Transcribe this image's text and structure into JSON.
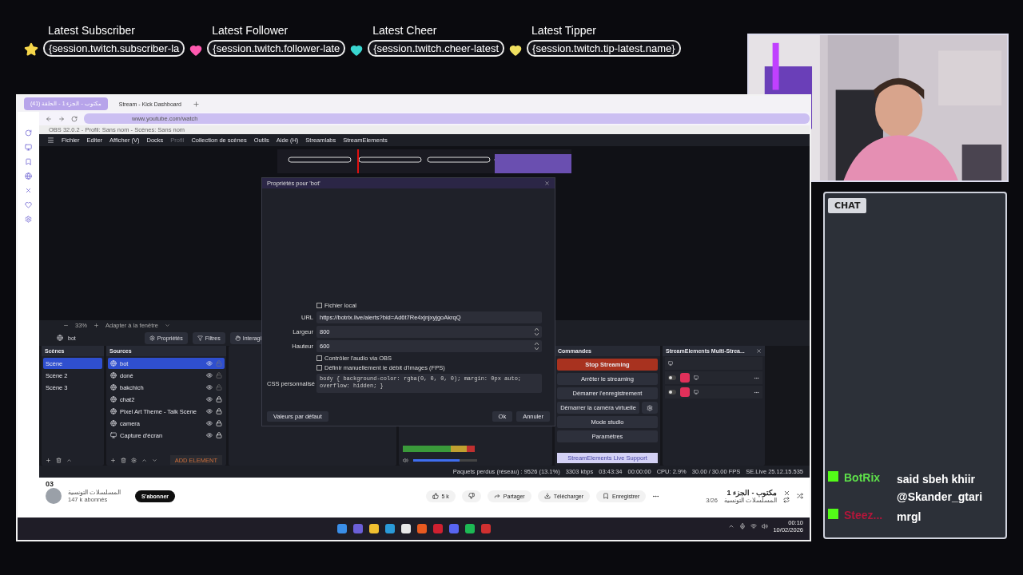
{
  "overlay": {
    "labels": [
      {
        "title": "Latest Subscriber",
        "value": "{session.twitch.subscriber-la"
      },
      {
        "title": "Latest Follower",
        "value": "{session.twitch.follower-late"
      },
      {
        "title": "Latest Cheer",
        "value": "{session.twitch.cheer-latest"
      },
      {
        "title": "Latest Tipper",
        "value": "{session.twitch.tip-latest.name}"
      }
    ]
  },
  "browser": {
    "tabs": [
      {
        "label": "(41) مكتوب - الجزء 1 - الحلقة",
        "selected": true
      },
      {
        "label": "Stream - Kick Dashboard",
        "selected": false
      }
    ],
    "url": "www.youtube.com/watch"
  },
  "obs": {
    "title": "OBS 32.0.2 - Profil: Sans nom - Scènes: Sans nom",
    "menu": [
      {
        "label": "Fichier",
        "disabled": false
      },
      {
        "label": "Editer",
        "disabled": false
      },
      {
        "label": "Afficher (V)",
        "disabled": false
      },
      {
        "label": "Docks",
        "disabled": false
      },
      {
        "label": "Profil",
        "disabled": true
      },
      {
        "label": "Collection de scènes",
        "disabled": false
      },
      {
        "label": "Outils",
        "disabled": false
      },
      {
        "label": "Aide (H)",
        "disabled": false
      },
      {
        "label": "Streamlabs",
        "disabled": false
      },
      {
        "label": "StreamElements",
        "disabled": false
      }
    ],
    "zoom": {
      "value": "33%",
      "fit": "Adapter à la fenêtre"
    },
    "source_bar": {
      "source": "bot",
      "buttons": [
        "Propriétés",
        "Filtres",
        "Interagi"
      ]
    },
    "scenes": {
      "title": "Scènes",
      "items": [
        {
          "label": "Scène",
          "selected": true
        },
        {
          "label": "Scène 2",
          "selected": false
        },
        {
          "label": "Scène 3",
          "selected": false
        }
      ]
    },
    "sources": {
      "title": "Sources",
      "add_button": "ADD ELEMENT",
      "items": [
        {
          "label": "bot",
          "kind": "browser",
          "selected": true,
          "locked": false
        },
        {
          "label": "doné",
          "kind": "browser",
          "selected": false,
          "locked": false
        },
        {
          "label": "bakchich",
          "kind": "browser",
          "selected": false,
          "locked": false
        },
        {
          "label": "chat2",
          "kind": "browser",
          "selected": false,
          "locked": true
        },
        {
          "label": "Pixel Art Theme - Talk Scene",
          "kind": "browser",
          "selected": false,
          "locked": true
        },
        {
          "label": "camera",
          "kind": "browser",
          "selected": false,
          "locked": true
        },
        {
          "label": "Capture d'écran",
          "kind": "display",
          "selected": false,
          "locked": true
        }
      ]
    },
    "mixer": {
      "level": 0.72
    },
    "commands": {
      "title": "Commandes",
      "support": "StreamElements Live Support",
      "buttons": [
        {
          "label": "Stop Streaming",
          "kind": "danger"
        },
        {
          "label": "Arrêter le streaming",
          "kind": "normal"
        },
        {
          "label": "Démarrer l'enregistrement",
          "kind": "normal"
        },
        {
          "label": "Démarrer la caméra virtuelle",
          "kind": "settings"
        },
        {
          "label": "Mode studio",
          "kind": "normal"
        },
        {
          "label": "Paramètres",
          "kind": "normal"
        }
      ]
    },
    "multistream": {
      "title": "StreamElements Multi-Strea...",
      "outputs": [
        {
          "on": false
        },
        {
          "on": false
        }
      ]
    },
    "status": [
      "Paquets perdus (réseau) : 9526 (13.1%)",
      "3303 kbps",
      "03:43:34",
      "00:00:00",
      "CPU: 2.9%",
      "30.00 / 30.00 FPS",
      "SE.Live 25.12.15.535"
    ],
    "dialog": {
      "title": "Propriétés pour 'bot'",
      "local_file": {
        "label": "Fichier local",
        "checked": false
      },
      "fields": [
        {
          "label": "URL",
          "value": "https://botrix.live/alerts?bid=Ad6t7Re4xjnjxyjgoAkrqQ",
          "kind": "text"
        },
        {
          "label": "Largeur",
          "value": "800",
          "kind": "spin"
        },
        {
          "label": "Hauteur",
          "value": "600",
          "kind": "spin"
        }
      ],
      "checks": [
        {
          "label": "Contrôler l'audio via OBS",
          "checked": false
        },
        {
          "label": "Définir manuellement le débit d'images (FPS)",
          "checked": false
        }
      ],
      "css_label": "CSS personnalisé",
      "css": "body { background-color: rgba(0, 0, 0, 0); margin: 0px auto; overflow: hidden; }",
      "defaults": "Valeurs par défaut",
      "ok": "Ok",
      "cancel": "Annuler"
    }
  },
  "youtube": {
    "episode": "03",
    "channel": "المسلسلات التونسية",
    "subscribers": "147 k abonnés",
    "subscribe": "S'abonner",
    "likes": "5 k",
    "actions": [
      "Partager",
      "Télécharger",
      "Enregistrer"
    ],
    "playlist_title": "مكتوب - الجزء 1",
    "playlist_channel": "المسلسلات التونسية",
    "playlist_pos": "3/26"
  },
  "taskbar": {
    "time": "00:10",
    "date": "10/02/2026"
  },
  "chat": {
    "title": "CHAT",
    "messages": [
      {
        "user": "BotRix",
        "color": "#5ee04a",
        "text": "said sbeh khiir @Skander_gtari"
      },
      {
        "user": "Steez...",
        "color": "#b3163a",
        "text": "mrgl"
      }
    ]
  }
}
